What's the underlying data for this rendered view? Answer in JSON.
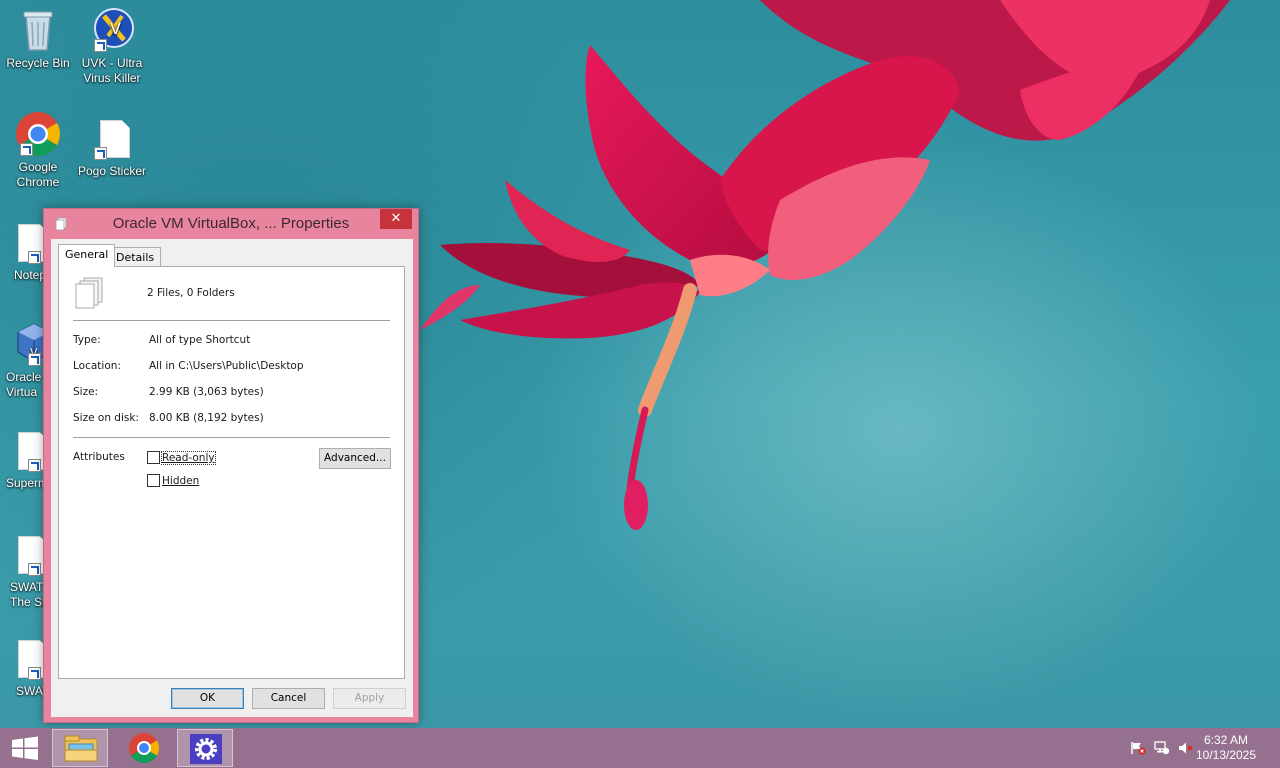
{
  "desktop": {
    "icons": [
      {
        "label": "Recycle Bin"
      },
      {
        "label": "UVK - Ultra Virus Killer"
      },
      {
        "label": "Google Chrome"
      },
      {
        "label": "Pogo Sticker"
      },
      {
        "label": "Notepa"
      },
      {
        "label": "Oracle Virtua"
      },
      {
        "label": "Superm"
      },
      {
        "label": "SWAT The St"
      },
      {
        "label": "SWAT"
      }
    ]
  },
  "dialog": {
    "title": "Oracle VM VirtualBox, ... Properties",
    "close_glyph": "✕",
    "tabs": [
      {
        "label": "General",
        "active": true
      },
      {
        "label": "Details",
        "active": false
      }
    ],
    "summary": "2 Files, 0 Folders",
    "properties": [
      {
        "label": "Type:",
        "value": "All of type Shortcut"
      },
      {
        "label": "Location:",
        "value": "All in C:\\Users\\Public\\Desktop"
      },
      {
        "label": "Size:",
        "value": "2.99 KB (3,063 bytes)"
      },
      {
        "label": "Size on disk:",
        "value": "8.00 KB (8,192 bytes)"
      }
    ],
    "attributes": {
      "label": "Attributes",
      "read_only": {
        "label": "Read-only",
        "checked": false
      },
      "hidden": {
        "label": "Hidden",
        "checked": false
      },
      "advanced_label": "Advanced..."
    },
    "buttons": {
      "ok": "OK",
      "cancel": "Cancel",
      "apply": "Apply"
    }
  },
  "taskbar": {
    "items": [
      {
        "icon": "file-explorer-icon",
        "active": true
      },
      {
        "icon": "chrome-icon",
        "active": false
      },
      {
        "icon": "settings-gear-icon",
        "active": true
      }
    ],
    "tray": [
      "action-center-flag-icon",
      "network-icon",
      "volume-muted-icon"
    ],
    "clock": {
      "time": "6:32 AM",
      "date": "10/13/2025"
    }
  },
  "colors": {
    "accent": "#e9849f",
    "close": "#c7333b",
    "taskbar": "#96708f"
  }
}
